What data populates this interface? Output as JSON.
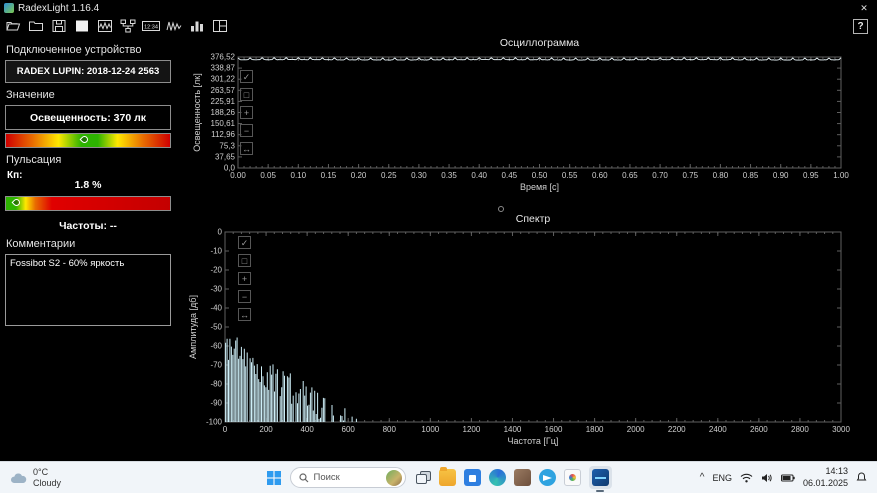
{
  "window": {
    "title": "RadexLight 1.16.4",
    "close_glyph": "✕",
    "help_glyph": "?"
  },
  "toolbar": {
    "clock_icon_text": "12:34",
    "buttons": [
      "open-file",
      "open-folder",
      "save",
      "snapshot",
      "wave-view",
      "device-tree",
      "clock",
      "signal-view",
      "histogram-view",
      "layout-view"
    ]
  },
  "sidebar": {
    "device_heading": "Подключенное устройство",
    "device_name": "RADEX LUPIN: 2018-12-24 2563",
    "value_heading": "Значение",
    "illuminance_text": "Освещенность: 370 лк",
    "pulsation_heading": "Пульсация",
    "kp_label": "Кп:",
    "kp_value": "1.8 %",
    "frequencies_text": "Частоты: --",
    "comments_heading": "Комментарии",
    "comment_text": "Fossibot S2 - 60% яркость",
    "illuminance_marker_pos": 0.48,
    "kp_marker_pos": 0.07,
    "colors": {
      "gauge_red": "#cf0000",
      "gauge_yellow": "#ffe800",
      "gauge_green": "#2db300"
    }
  },
  "chart_tools": [
    {
      "name": "select-tool",
      "glyph": "✓"
    },
    {
      "name": "pan-tool",
      "glyph": "□"
    },
    {
      "name": "zoom-in-tool",
      "glyph": "+"
    },
    {
      "name": "zoom-out-tool",
      "glyph": "−"
    },
    {
      "name": "fit-tool",
      "glyph": "↔"
    }
  ],
  "chart_data": [
    {
      "type": "line",
      "title": "Осциллограмма",
      "xlabel": "Время [с]",
      "ylabel": "Освещенность [лк]",
      "x_ticks": [
        "0.00",
        "0.05",
        "0.10",
        "0.15",
        "0.20",
        "0.25",
        "0.30",
        "0.35",
        "0.40",
        "0.45",
        "0.50",
        "0.55",
        "0.60",
        "0.65",
        "0.70",
        "0.75",
        "0.80",
        "0.85",
        "0.90",
        "0.95",
        "1.00"
      ],
      "y_ticks": [
        "376,52",
        "338,87",
        "301,22",
        "263,57",
        "225,91",
        "188,26",
        "150,61",
        "112,96",
        "75,3",
        "37,65",
        "0,0"
      ],
      "xlim": [
        0,
        1
      ],
      "ylim": [
        0,
        376.52
      ],
      "grid": false,
      "signal": {
        "baseline_lux": 367,
        "ripple_lux": 6.5,
        "flicker_hz": 50,
        "noise_lux": 1.0,
        "mean_lux": 370,
        "pulsation_pct": 1.8
      },
      "line_color": "#eaf6fa"
    },
    {
      "type": "area",
      "title": "Спектр",
      "xlabel": "Частота [Гц]",
      "ylabel": "Амплитуда [дб]",
      "x_ticks": [
        "0",
        "200",
        "400",
        "600",
        "800",
        "1000",
        "1200",
        "1400",
        "1600",
        "1800",
        "2000",
        "2200",
        "2400",
        "2600",
        "2800",
        "3000"
      ],
      "y_ticks": [
        "0",
        "-10",
        "-20",
        "-30",
        "-40",
        "-50",
        "-60",
        "-70",
        "-80",
        "-90",
        "-100"
      ],
      "xlim": [
        0,
        3000
      ],
      "ylim": [
        -100,
        0
      ],
      "grid": false,
      "spectrum": {
        "band_end_hz": 640,
        "peak_db": -56,
        "floor_db": -100,
        "note": "broadband noise 0-640 Hz decaying from -56 dB to below -100 dB; nothing above 640 Hz"
      },
      "fill_color": "#cdeef7"
    }
  ],
  "taskbar": {
    "weather": {
      "temp": "0°C",
      "desc": "Cloudy"
    },
    "search": {
      "placeholder": "Поиск"
    },
    "apps": [
      "start",
      "task-view",
      "file-explorer",
      "store",
      "edge",
      "files-brown",
      "telegram",
      "photos",
      "radexlight-active"
    ],
    "tray": {
      "chevron": "^",
      "lang": "ENG",
      "time": "14:13",
      "date": "06.01.2025"
    }
  }
}
